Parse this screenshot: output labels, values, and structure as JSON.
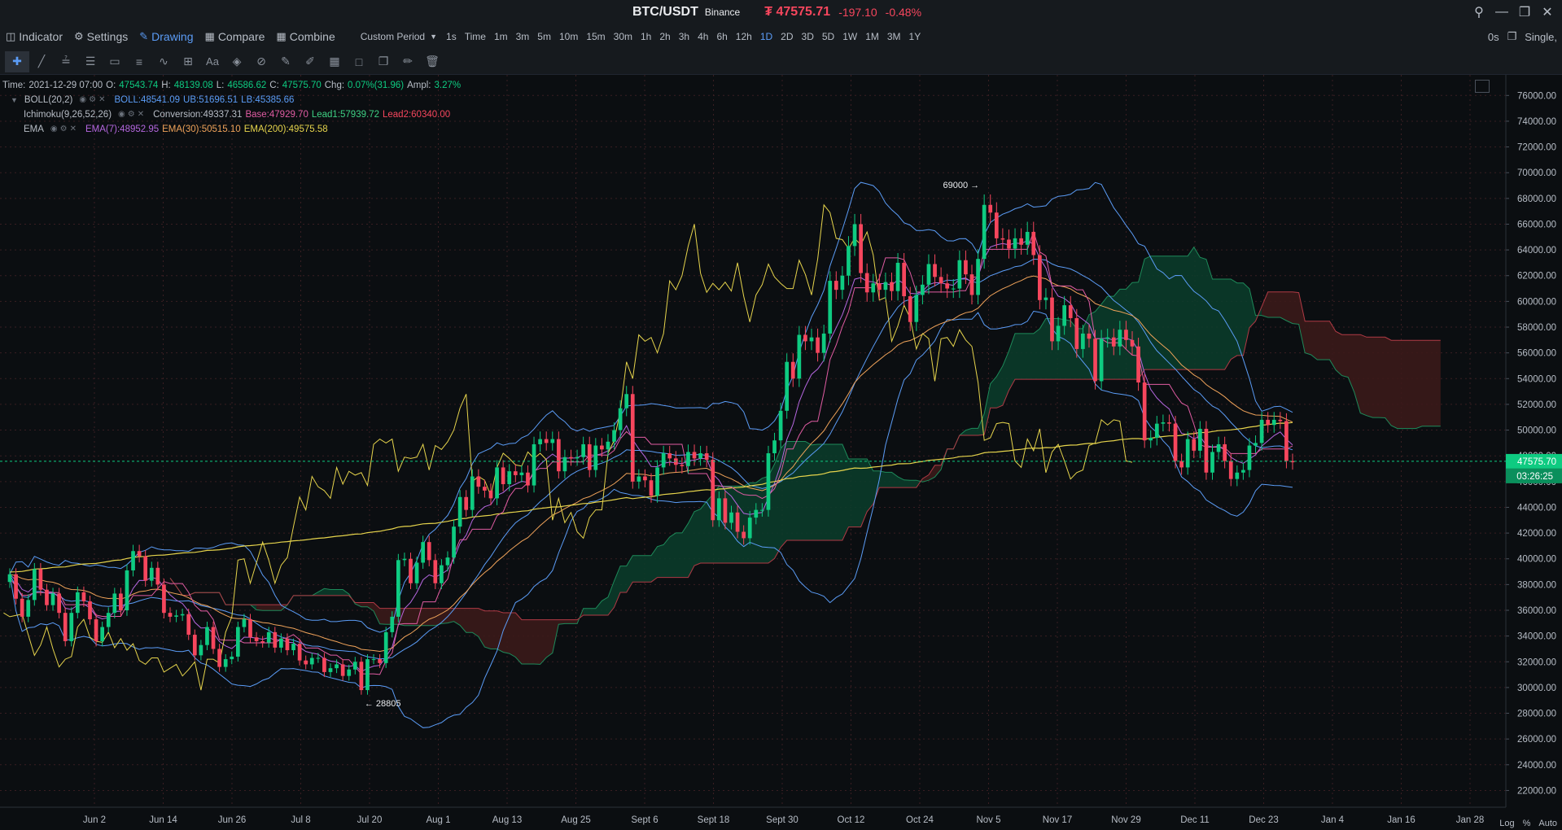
{
  "titlebar": {
    "pair": "BTC/USDT",
    "exchange": "Binance",
    "price": "₮ 47575.71",
    "change": "-197.10",
    "change_pct": "-0.48%"
  },
  "toolbar": {
    "indicator": "Indicator",
    "settings": "Settings",
    "drawing": "Drawing",
    "compare": "Compare",
    "combine": "Combine",
    "custom_period": "Custom Period",
    "periods": [
      "1s",
      "Time",
      "1m",
      "3m",
      "5m",
      "10m",
      "15m",
      "30m",
      "1h",
      "2h",
      "3h",
      "4h",
      "6h",
      "12h",
      "1D",
      "2D",
      "3D",
      "5D",
      "1W",
      "1M",
      "3M",
      "1Y"
    ],
    "active_period": "1D",
    "right_timer": "0s",
    "right_mode": "Single"
  },
  "legend": {
    "time_label": "Time:",
    "time": "2021-12-29 07:00",
    "open_label": "O:",
    "open": "47543.74",
    "high_label": "H:",
    "high": "48139.08",
    "low_label": "L:",
    "low": "46586.62",
    "close_label": "C:",
    "close": "47575.70",
    "chg_label": "Chg:",
    "chg": "0.07%(31.96)",
    "ampl_label": "Ampl:",
    "ampl": "3.27%",
    "boll_name": "BOLL(20,2)",
    "boll": "BOLL:48541.09",
    "boll_ub": "UB:51696.51",
    "boll_lb": "LB:45385.66",
    "ichimoku_name": "Ichimoku(9,26,52,26)",
    "conversion": "Conversion:49337.31",
    "base": "Base:47929.70",
    "lead1": "Lead1:57939.72",
    "lead2": "Lead2:60340.00",
    "ema_name": "EMA",
    "ema7": "EMA(7):48952.95",
    "ema30": "EMA(30):50515.10",
    "ema200": "EMA(200):49575.58"
  },
  "price_tag": {
    "value": "47575.70",
    "countdown": "03:26:25"
  },
  "axis_controls": {
    "log": "Log",
    "pct": "%",
    "auto": "Auto"
  },
  "chart_data": {
    "type": "candlestick",
    "symbol": "BTC/USDT",
    "y_ticks": [
      22000,
      24000,
      26000,
      28000,
      30000,
      32000,
      34000,
      36000,
      38000,
      40000,
      42000,
      44000,
      46000,
      48000,
      50000,
      52000,
      54000,
      56000,
      58000,
      60000,
      62000,
      64000,
      66000,
      68000,
      70000,
      72000,
      74000,
      76000
    ],
    "y_tick_labels": [
      "22000.00",
      "24000.00",
      "26000.00",
      "28000.00",
      "30000.00",
      "32000.00",
      "34000.00",
      "36000.00",
      "38000.00",
      "40000.00",
      "42000.00",
      "44000.00",
      "46000.00",
      "48000.00",
      "50000.00",
      "52000.00",
      "54000.00",
      "56000.00",
      "58000.00",
      "60000.00",
      "62000.00",
      "64000.00",
      "66000.00",
      "68000.00",
      "70000.00",
      "72000.00",
      "74000.00",
      "76000.00"
    ],
    "ylim": [
      20700,
      77600
    ],
    "x_tick_labels": [
      "Jun 2",
      "Jun 14",
      "Jun 26",
      "Jul 8",
      "Jul 20",
      "Aug 1",
      "Aug 13",
      "Aug 25",
      "Sept 6",
      "Sept 18",
      "Sept 30",
      "Oct 12",
      "Oct 24",
      "Nov 5",
      "Nov 17",
      "Nov 29",
      "Dec 11",
      "Dec 23",
      "Jan 4",
      "Jan 16",
      "Jan 28"
    ],
    "annotations": {
      "high_label": "69000",
      "high_value": 69000,
      "low_label": "28805",
      "low_value": 28805
    },
    "last_price": 47575.7,
    "colors": {
      "up": "#0ecb81",
      "down": "#f6465d",
      "boll": "#5b9cf6",
      "ema7": "#b667e0",
      "ema30": "#f0a35a",
      "ema200": "#e6d44c",
      "conversion": "#e05ca3",
      "lagging": "#e6d44c",
      "cloud_bull": "#0b3d2b",
      "cloud_bear": "#3d1a1a"
    },
    "closes": [
      38800,
      36900,
      35500,
      36800,
      39200,
      37600,
      36400,
      37300,
      35800,
      33600,
      35800,
      37400,
      36700,
      35300,
      33600,
      34700,
      35800,
      37300,
      36000,
      39100,
      40600,
      40200,
      38300,
      39300,
      38000,
      35800,
      35500,
      35600,
      35700,
      34100,
      32500,
      33300,
      34700,
      33000,
      31600,
      32200,
      32400,
      34700,
      35300,
      33900,
      33600,
      33500,
      34300,
      33100,
      33800,
      32900,
      33400,
      32100,
      31800,
      32300,
      32300,
      31200,
      31500,
      31800,
      30900,
      31400,
      32000,
      29800,
      32200,
      32200,
      31900,
      34300,
      35500,
      39900,
      40000,
      38100,
      39700,
      41300,
      39900,
      38100,
      39500,
      40100,
      42500,
      44800,
      43800,
      46400,
      45600,
      45300,
      44700,
      47100,
      45800,
      46800,
      46500,
      46700,
      45700,
      48900,
      49300,
      49000,
      49300,
      46800,
      47900,
      47800,
      47900,
      48900,
      46900,
      48800,
      48500,
      49100,
      50000,
      51700,
      52800,
      46000,
      46400,
      46100,
      44900,
      47100,
      48200,
      47800,
      47300,
      47200,
      48300,
      47800,
      48200,
      47700,
      43000,
      44700,
      42800,
      43600,
      42100,
      41600,
      43200,
      43800,
      43800,
      48200,
      49200,
      51500,
      55300,
      54000,
      57400,
      56900,
      57200,
      56000,
      57500,
      61600,
      60900,
      62000,
      64300,
      66000,
      62200,
      60700,
      61400,
      60900,
      61500,
      60800,
      63000,
      60400,
      58400,
      60500,
      61300,
      62900,
      61900,
      61400,
      61000,
      61000,
      63200,
      62100,
      60500,
      63300,
      67500,
      66900,
      64900,
      64800,
      64100,
      64900,
      64400,
      65400,
      63600,
      60100,
      60300,
      56900,
      58100,
      59700,
      58700,
      56300,
      57500,
      57100,
      53800,
      57100,
      57200,
      56500,
      57800,
      57000,
      56500,
      53700,
      49200,
      49400,
      50500,
      50600,
      50500,
      47600,
      47100,
      49300,
      48400,
      50100,
      46700,
      48300,
      48900,
      47600,
      46200,
      46700,
      46900,
      48800,
      49000,
      50800,
      50400,
      50800,
      50700,
      47600,
      47500
    ]
  }
}
